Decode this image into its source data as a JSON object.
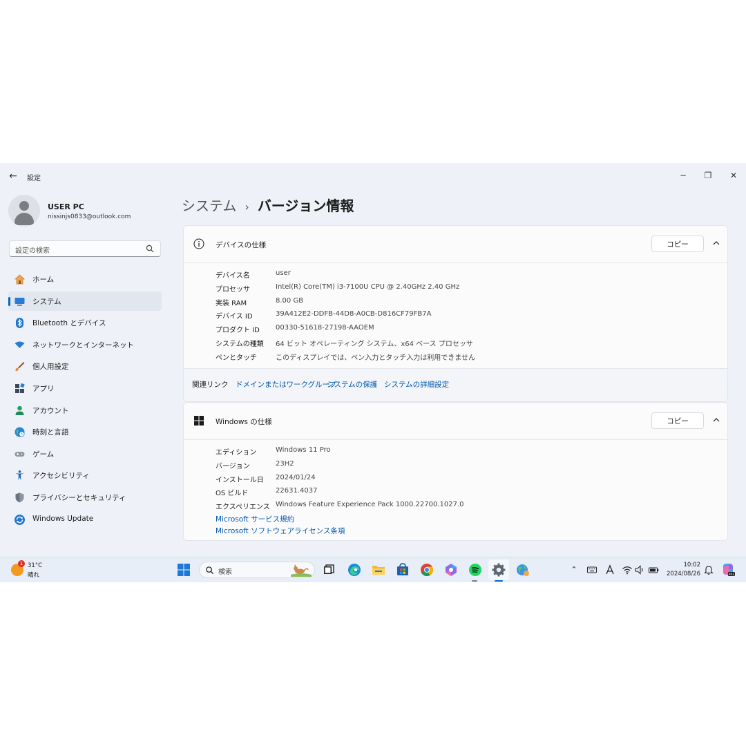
{
  "window": {
    "back_icon": "arrow-left-icon",
    "app_title": "設定",
    "controls": {
      "minimize": "─",
      "maximize": "❐",
      "close": "✕"
    }
  },
  "profile": {
    "name": "USER PC",
    "email": "nissinjs0833@outlook.com"
  },
  "search": {
    "placeholder": "設定の検索"
  },
  "nav": {
    "selected_index": 1,
    "items": [
      {
        "label": "ホーム",
        "icon": "home-icon"
      },
      {
        "label": "システム",
        "icon": "system-icon"
      },
      {
        "label": "Bluetooth とデバイス",
        "icon": "bluetooth-icon"
      },
      {
        "label": "ネットワークとインターネット",
        "icon": "network-icon"
      },
      {
        "label": "個人用設定",
        "icon": "brush-icon"
      },
      {
        "label": "アプリ",
        "icon": "apps-icon"
      },
      {
        "label": "アカウント",
        "icon": "account-icon"
      },
      {
        "label": "時刻と言語",
        "icon": "time-language-icon"
      },
      {
        "label": "ゲーム",
        "icon": "gaming-icon"
      },
      {
        "label": "アクセシビリティ",
        "icon": "accessibility-icon"
      },
      {
        "label": "プライバシーとセキュリティ",
        "icon": "shield-icon"
      },
      {
        "label": "Windows Update",
        "icon": "windows-update-icon"
      }
    ]
  },
  "breadcrumb": {
    "parent": "システム",
    "separator": "›",
    "current": "バージョン情報"
  },
  "device_specs": {
    "title": "デバイスの仕様",
    "copy_label": "コピー",
    "rows": [
      {
        "label": "デバイス名",
        "value": "user"
      },
      {
        "label": "プロセッサ",
        "value": "Intel(R) Core(TM) i3-7100U CPU @ 2.40GHz   2.40 GHz"
      },
      {
        "label": "実装 RAM",
        "value": "8.00 GB"
      },
      {
        "label": "デバイス ID",
        "value": "39A412E2-DDFB-44D8-A0CB-D816CF79FB7A"
      },
      {
        "label": "プロダクト ID",
        "value": "00330-51618-27198-AAOEM"
      },
      {
        "label": "システムの種類",
        "value": "64 ビット オペレーティング システム、x64 ベース プロセッサ"
      },
      {
        "label": "ペンとタッチ",
        "value": "このディスプレイでは、ペン入力とタッチ入力は利用できません"
      }
    ],
    "related": {
      "title": "関連リンク",
      "links": [
        "ドメインまたはワークグループ",
        "システムの保護",
        "システムの詳細設定"
      ]
    }
  },
  "windows_specs": {
    "title": "Windows の仕様",
    "copy_label": "コピー",
    "rows": [
      {
        "label": "エディション",
        "value": "Windows 11 Pro"
      },
      {
        "label": "バージョン",
        "value": "23H2"
      },
      {
        "label": "インストール日",
        "value": "2024/01/24"
      },
      {
        "label": "OS ビルド",
        "value": "22631.4037"
      },
      {
        "label": "エクスペリエンス",
        "value": "Windows Feature Experience Pack 1000.22700.1027.0"
      }
    ],
    "links": [
      "Microsoft サービス規約",
      "Microsoft ソフトウェアライセンス条項"
    ]
  },
  "taskbar": {
    "weather": {
      "temp": "31°C",
      "condition": "晴れ",
      "badge": "1"
    },
    "search_placeholder": "検索",
    "time": "10:02",
    "date": "2024/08/26",
    "accent": "#0067c0"
  }
}
